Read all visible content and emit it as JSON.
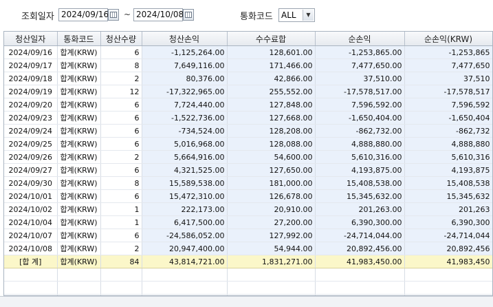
{
  "filter": {
    "date_label": "조회일자",
    "date_from": "2024/09/16",
    "separator": "~",
    "date_to": "2024/10/08",
    "currency_label": "통화코드",
    "currency_value": "ALL"
  },
  "table": {
    "headers": [
      "청산일자",
      "통화코드",
      "청산수량",
      "청산손익",
      "수수료합",
      "순손익",
      "순손익(KRW)"
    ],
    "rows": [
      [
        "2024/09/16",
        "합계(KRW)",
        "6",
        "-1,125,264.00",
        "128,601.00",
        "-1,253,865.00",
        "-1,253,865"
      ],
      [
        "2024/09/17",
        "합계(KRW)",
        "8",
        "7,649,116.00",
        "171,466.00",
        "7,477,650.00",
        "7,477,650"
      ],
      [
        "2024/09/18",
        "합계(KRW)",
        "2",
        "80,376.00",
        "42,866.00",
        "37,510.00",
        "37,510"
      ],
      [
        "2024/09/19",
        "합계(KRW)",
        "12",
        "-17,322,965.00",
        "255,552.00",
        "-17,578,517.00",
        "-17,578,517"
      ],
      [
        "2024/09/20",
        "합계(KRW)",
        "6",
        "7,724,440.00",
        "127,848.00",
        "7,596,592.00",
        "7,596,592"
      ],
      [
        "2024/09/23",
        "합계(KRW)",
        "6",
        "-1,522,736.00",
        "127,668.00",
        "-1,650,404.00",
        "-1,650,404"
      ],
      [
        "2024/09/24",
        "합계(KRW)",
        "6",
        "-734,524.00",
        "128,208.00",
        "-862,732.00",
        "-862,732"
      ],
      [
        "2024/09/25",
        "합계(KRW)",
        "6",
        "5,016,968.00",
        "128,088.00",
        "4,888,880.00",
        "4,888,880"
      ],
      [
        "2024/09/26",
        "합계(KRW)",
        "2",
        "5,664,916.00",
        "54,600.00",
        "5,610,316.00",
        "5,610,316"
      ],
      [
        "2024/09/27",
        "합계(KRW)",
        "6",
        "4,321,525.00",
        "127,650.00",
        "4,193,875.00",
        "4,193,875"
      ],
      [
        "2024/09/30",
        "합계(KRW)",
        "8",
        "15,589,538.00",
        "181,000.00",
        "15,408,538.00",
        "15,408,538"
      ],
      [
        "2024/10/01",
        "합계(KRW)",
        "6",
        "15,472,310.00",
        "126,678.00",
        "15,345,632.00",
        "15,345,632"
      ],
      [
        "2024/10/02",
        "합계(KRW)",
        "1",
        "222,173.00",
        "20,910.00",
        "201,263.00",
        "201,263"
      ],
      [
        "2024/10/04",
        "합계(KRW)",
        "1",
        "6,417,500.00",
        "27,200.00",
        "6,390,300.00",
        "6,390,300"
      ],
      [
        "2024/10/07",
        "합계(KRW)",
        "6",
        "-24,586,052.00",
        "127,992.00",
        "-24,714,044.00",
        "-24,714,044"
      ],
      [
        "2024/10/08",
        "합계(KRW)",
        "2",
        "20,947,400.00",
        "54,944.00",
        "20,892,456.00",
        "20,892,456"
      ]
    ],
    "total": [
      "[합 계]",
      "합계(KRW)",
      "84",
      "43,814,721.00",
      "1,831,271.00",
      "41,983,450.00",
      "41,983,450"
    ]
  },
  "colors": {
    "row_blue": "#eaf1fb",
    "total_yellow": "#fbf7c9"
  },
  "icons": {
    "calendar": "calendar-icon",
    "dropdown": "chevron-down-icon"
  }
}
